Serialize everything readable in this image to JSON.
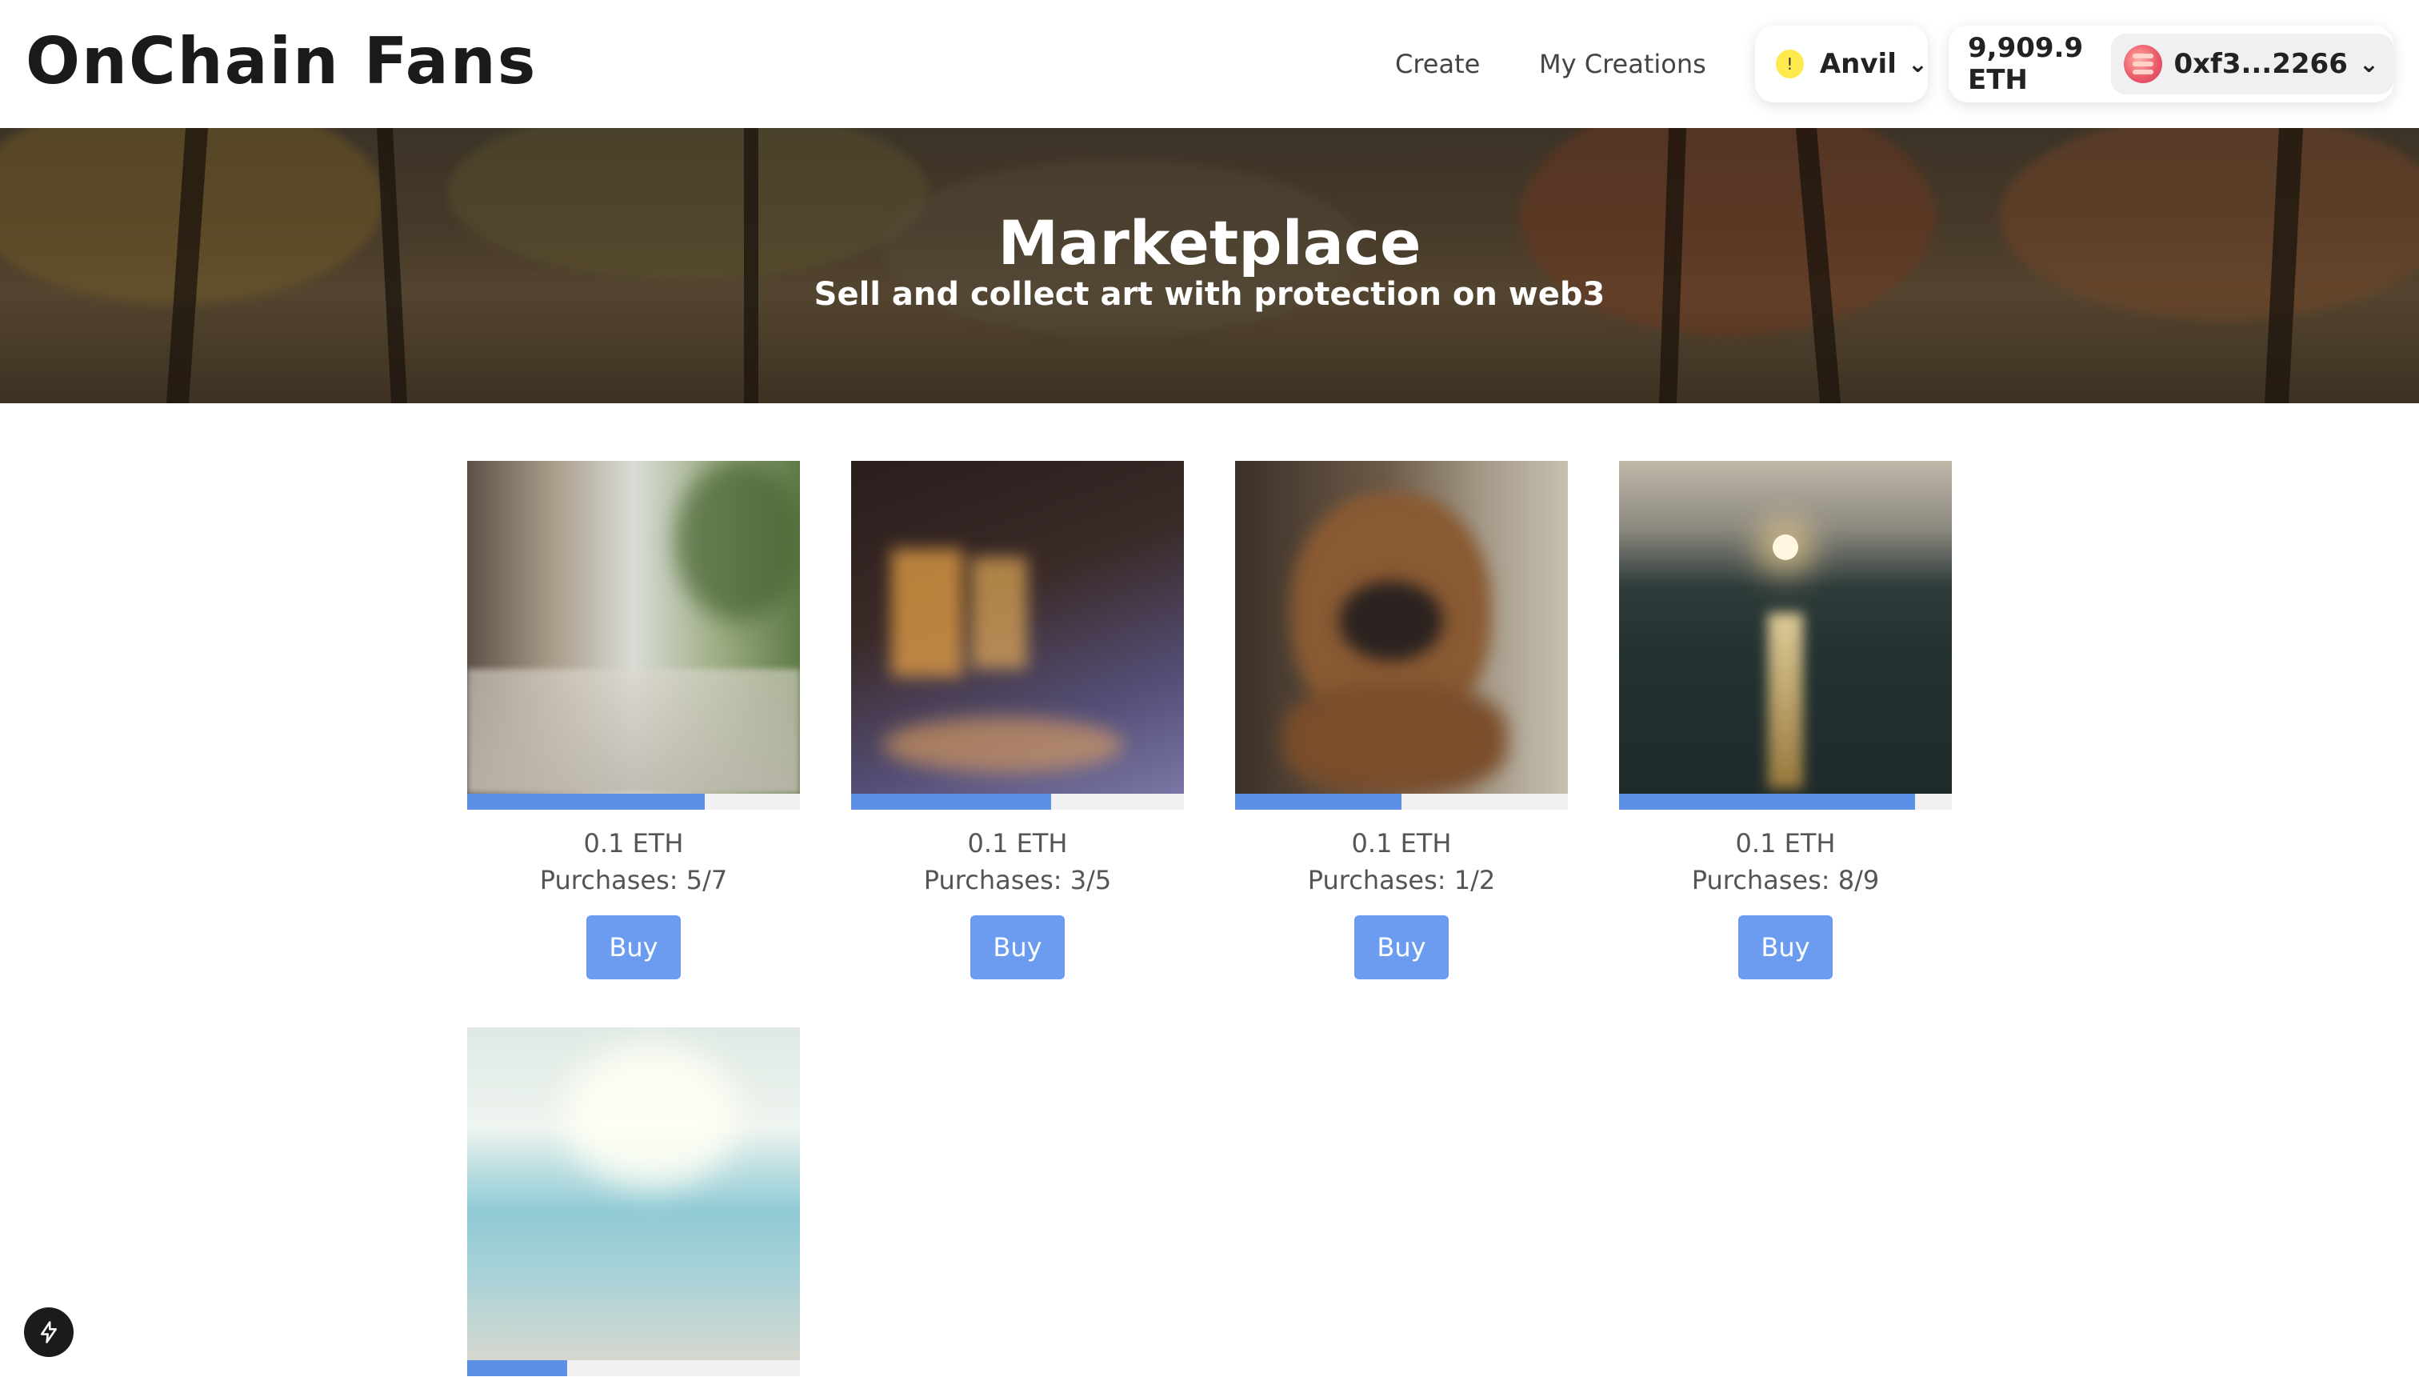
{
  "header": {
    "logo": "OnChain Fans",
    "nav": {
      "create": "Create",
      "my_creations": "My Creations"
    },
    "network": {
      "label": "Anvil",
      "icon": "warning-icon"
    },
    "account": {
      "balance": "9,909.9 ETH",
      "address": "0xf3...2266",
      "icon": "avatar"
    }
  },
  "hero": {
    "title": "Marketplace",
    "subtitle": "Sell and collect art with protection on web3"
  },
  "listings": [
    {
      "price": "0.1 ETH",
      "purchases": "Purchases: 5/7",
      "buy_label": "Buy",
      "progress": 0.714
    },
    {
      "price": "0.1 ETH",
      "purchases": "Purchases: 3/5",
      "buy_label": "Buy",
      "progress": 0.6
    },
    {
      "price": "0.1 ETH",
      "purchases": "Purchases: 1/2",
      "buy_label": "Buy",
      "progress": 0.5
    },
    {
      "price": "0.1 ETH",
      "purchases": "Purchases: 8/9",
      "buy_label": "Buy",
      "progress": 0.889
    },
    {
      "progress": 0.3
    }
  ],
  "colors": {
    "accent": "#6b9cf0",
    "progress": "#5b90e6"
  }
}
